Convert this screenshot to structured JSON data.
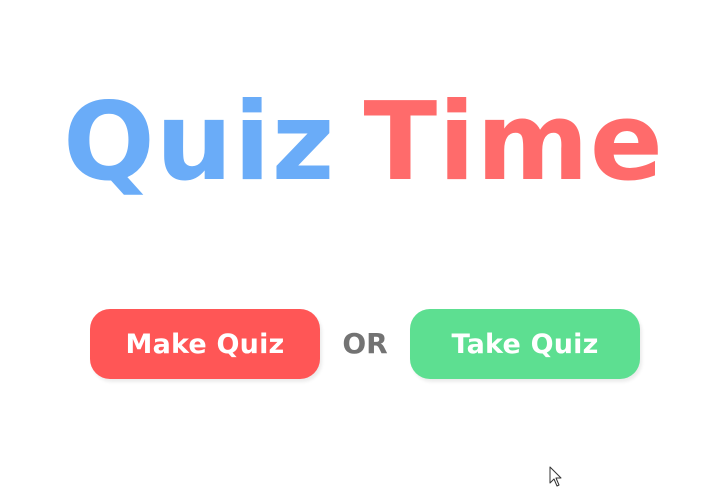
{
  "title": {
    "word1": "Quiz",
    "word2": "Time",
    "word1_color": "#6aacf8",
    "word2_color": "#ff6b6b"
  },
  "actions": {
    "make_quiz_label": "Make Quiz",
    "or_label": "OR",
    "take_quiz_label": "Take Quiz",
    "make_quiz_color": "#ff5656",
    "take_quiz_color": "#5ddf91"
  },
  "cursor": {
    "icon": "mouse-pointer-icon"
  }
}
